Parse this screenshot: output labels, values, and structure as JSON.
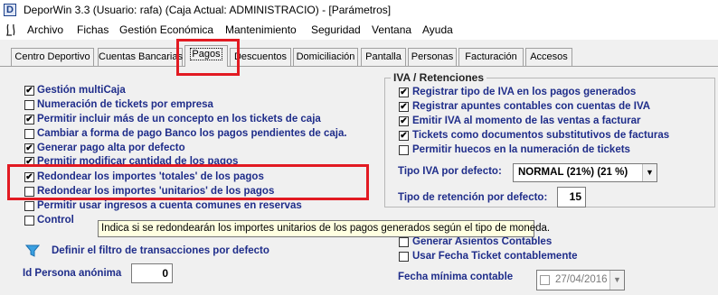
{
  "window": {
    "title": "DeporWin 3.3  (Usuario: rafa)  (Caja Actual: ADMINISTRACIO) - [Parámetros]",
    "icon_letter": "D"
  },
  "menu": [
    "Archivo",
    "Fichas",
    "Gestión Económica",
    "Mantenimiento",
    "Seguridad",
    "Ventana",
    "Ayuda"
  ],
  "tabs": [
    "Centro Deportivo",
    "Cuentas Bancarias",
    "Pagos",
    "Descuentos",
    "Domiciliación",
    "Pantalla",
    "Personas",
    "Facturación",
    "Accesos"
  ],
  "active_tab": "Pagos",
  "left_options": [
    {
      "label": "Gestión multiCaja",
      "checked": true
    },
    {
      "label": "Numeración de tickets por empresa",
      "checked": false
    },
    {
      "label": "Permitir incluir más de un concepto en los tickets de caja",
      "checked": true
    },
    {
      "label": "Cambiar a forma de pago Banco los pagos pendientes de caja.",
      "checked": false
    },
    {
      "label": "Generar pago alta por defecto",
      "checked": true
    },
    {
      "label": "Permitir modificar cantidad de los pagos",
      "checked": true
    },
    {
      "label": "Redondear los importes 'totales' de los pagos",
      "checked": true
    },
    {
      "label": "Redondear los importes 'unitarios' de los pagos",
      "checked": false
    },
    {
      "label": "Permitir usar ingresos a cuenta comunes en reservas",
      "checked": false
    },
    {
      "label": "Control",
      "checked": false
    }
  ],
  "iva_group": {
    "title": "IVA / Retenciones",
    "options": [
      {
        "label": "Registrar tipo de IVA en los pagos generados",
        "checked": true
      },
      {
        "label": "Registrar apuntes contables con cuentas de IVA",
        "checked": true
      },
      {
        "label": "Emitir IVA al momento de las ventas a facturar",
        "checked": true
      },
      {
        "label": "Tickets como documentos substitutivos de facturas",
        "checked": true
      },
      {
        "label": "Permitir huecos en la numeración de tickets",
        "checked": false
      }
    ],
    "tipo_iva_label": "Tipo IVA por defecto:",
    "tipo_iva_value": "NORMAL (21%)  (21 %)",
    "retencion_label": "Tipo de retención por defecto:",
    "retencion_value": "15"
  },
  "contab_options": [
    {
      "label": "Generar Asientos Contables",
      "checked": false
    },
    {
      "label": "Usar Fecha Ticket contablemente",
      "checked": false
    }
  ],
  "fecha_minima_label": "Fecha mínima contable",
  "fecha_minima_value": "27/04/2016",
  "filter_link": "Definir el filtro de transacciones por defecto",
  "persona_label": "Id Persona anónima",
  "persona_value": "0",
  "tooltip": "Indica si se redondearán los importes unitarios de los pagos generados según el tipo de moneda.",
  "colors": {
    "label_blue": "#1f2d8a",
    "highlight_red": "#e21a22",
    "tooltip_bg": "#ffffe1"
  }
}
